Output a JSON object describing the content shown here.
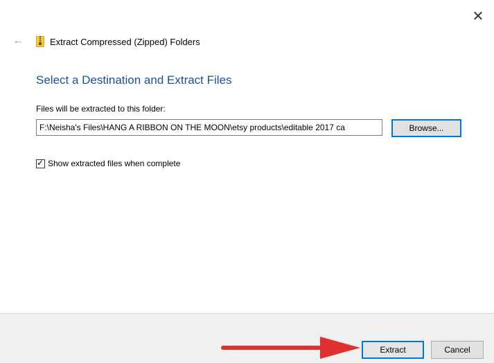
{
  "window": {
    "title": "Extract Compressed (Zipped) Folders",
    "close_glyph": "✕",
    "back_glyph": "←"
  },
  "main": {
    "heading": "Select a Destination and Extract Files",
    "path_label": "Files will be extracted to this folder:",
    "path_value": "F:\\Neisha's Files\\HANG A RIBBON ON THE MOON\\etsy products\\editable 2017 ca",
    "browse_label": "Browse...",
    "show_files_checked": true,
    "show_files_label": "Show extracted files when complete",
    "checkmark_glyph": "✓"
  },
  "footer": {
    "extract_label": "Extract",
    "cancel_label": "Cancel"
  },
  "colors": {
    "heading": "#1a4f9c",
    "focus_border": "#0078d7",
    "annotation_arrow": "#e03131"
  },
  "icons": [
    "close-icon",
    "back-arrow-icon",
    "zip-folder-icon",
    "checkmark-icon",
    "annotation-arrow-icon"
  ]
}
